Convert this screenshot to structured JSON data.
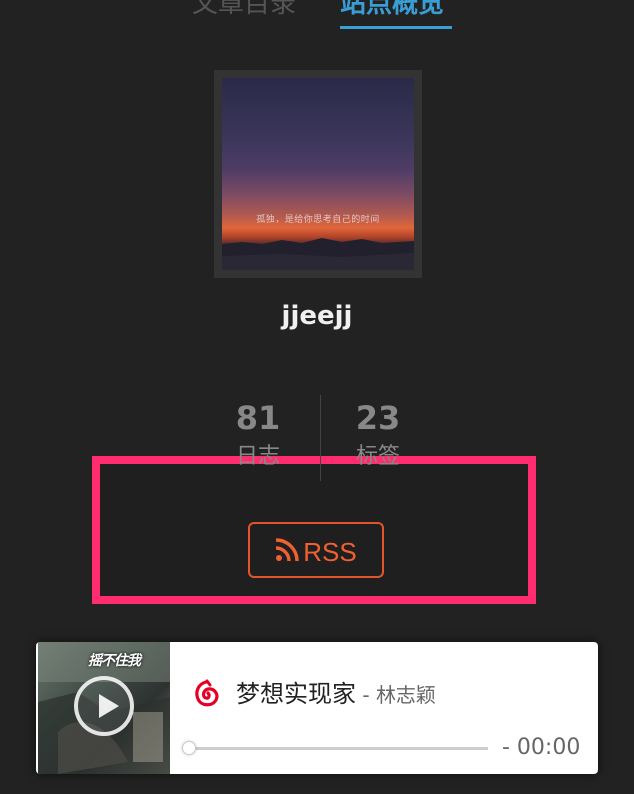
{
  "tabs": {
    "toc_label": "文章目录",
    "overview_label": "站点概览"
  },
  "author": {
    "avatar_caption": "孤独，是给你思考自己的时间",
    "name": "jjeejj"
  },
  "stats": {
    "posts_count": "81",
    "posts_label": "日志",
    "tags_count": "23",
    "tags_label": "标签"
  },
  "rss": {
    "label": "RSS",
    "icon": "rss-icon",
    "color": "#f06030"
  },
  "highlight": {
    "color": "#ff2d6f"
  },
  "player": {
    "cover_title": "摇不住我",
    "song_title": "梦想实现家",
    "separator": " - ",
    "artist": "林志颖",
    "time": "- 00:00",
    "progress": 0,
    "icon": "netease-music-icon",
    "icon_color": "#e60026"
  },
  "theme": {
    "background": "#222222",
    "accent": "#3a9ed6"
  }
}
